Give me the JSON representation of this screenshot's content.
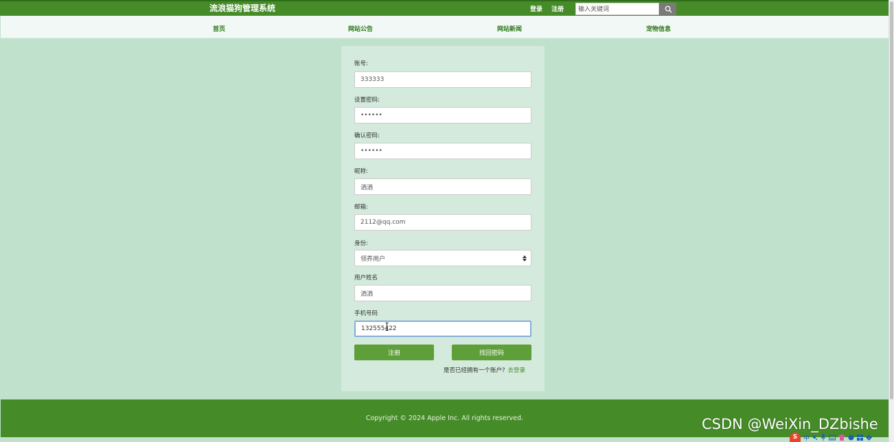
{
  "header": {
    "title": "流浪猫狗管理系统",
    "login_label": "登录",
    "register_label": "注册",
    "search_placeholder": "输入关键词"
  },
  "nav": {
    "items": [
      {
        "label": "首页"
      },
      {
        "label": "网站公告"
      },
      {
        "label": "网站新闻"
      },
      {
        "label": "宠物信息"
      }
    ]
  },
  "form": {
    "account": {
      "label": "账号:",
      "value": "333333"
    },
    "password": {
      "label": "设置密码:",
      "value": "••••••"
    },
    "confirm_password": {
      "label": "确认密码:",
      "value": "••••••"
    },
    "nickname": {
      "label": "昵称:",
      "value": "洒洒"
    },
    "email": {
      "label": "邮箱:",
      "value": "2112@qq.com"
    },
    "role": {
      "label": "身份:",
      "value": "领养用户"
    },
    "realname": {
      "label": "用户姓名",
      "value": "洒洒"
    },
    "phone": {
      "label": "手机号码",
      "value": "132555422"
    },
    "register_button": "注册",
    "forgot_button": "找回密码",
    "has_account_text": "是否已经拥有一个账户?",
    "login_link": "去登录"
  },
  "footer": {
    "copyright": "Copyright © 2024 Apple Inc. All rights reserved."
  },
  "watermark": "CSDN @WeiXin_DZbishe",
  "tray": {
    "ime_badge": "S",
    "ime_lang": "中"
  },
  "colors": {
    "brand_green": "#458c28",
    "page_bg": "#c0e2cd",
    "button_green": "#5e9f3a"
  }
}
